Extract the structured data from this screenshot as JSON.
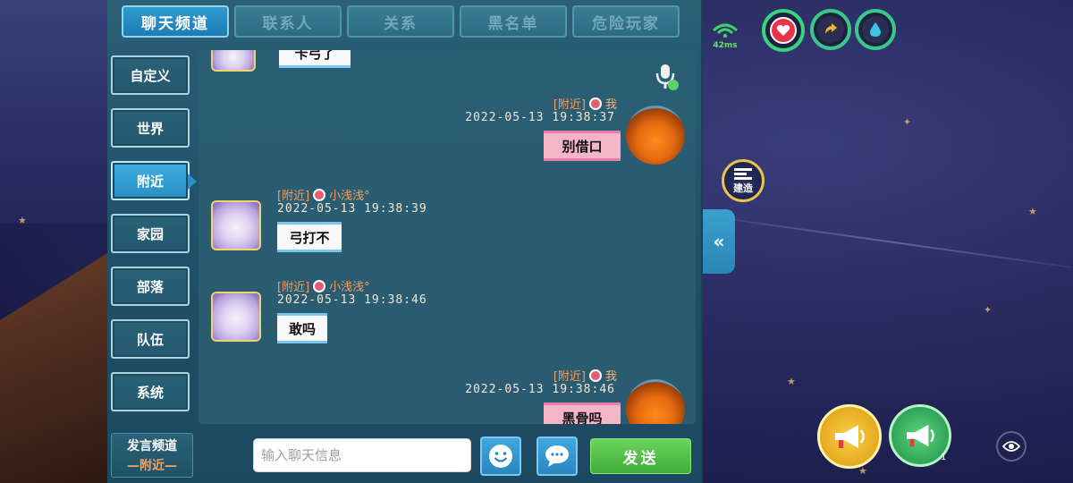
{
  "tabs": [
    {
      "label": "聊天频道",
      "active": true
    },
    {
      "label": "联系人",
      "active": false
    },
    {
      "label": "关系",
      "active": false
    },
    {
      "label": "黑名单",
      "active": false
    },
    {
      "label": "危险玩家",
      "active": false
    }
  ],
  "sidebar": {
    "items": [
      {
        "label": "自定义",
        "active": false
      },
      {
        "label": "世界",
        "active": false
      },
      {
        "label": "附近",
        "active": true
      },
      {
        "label": "家园",
        "active": false
      },
      {
        "label": "部落",
        "active": false
      },
      {
        "label": "队伍",
        "active": false
      },
      {
        "label": "系统",
        "active": false
      }
    ]
  },
  "messages": [
    {
      "channel": "",
      "name": "",
      "time": "",
      "text": "卡弓了",
      "side": "left",
      "partial": true
    },
    {
      "channel": "[附近]",
      "name": "我",
      "time": "2022-05-13  19:38:37",
      "text": "别借口",
      "side": "right"
    },
    {
      "channel": "[附近]",
      "name": "小浅浅°",
      "time": "2022-05-13  19:38:39",
      "text": "弓打不",
      "side": "left"
    },
    {
      "channel": "[附近]",
      "name": "小浅浅°",
      "time": "2022-05-13  19:38:46",
      "text": "敢吗",
      "side": "left"
    },
    {
      "channel": "[附近]",
      "name": "我",
      "time": "2022-05-13  19:38:46",
      "text": "黑骨吗",
      "side": "right"
    }
  ],
  "input_bar": {
    "channel_label": "发言频道",
    "channel_value": "—附近—",
    "placeholder": "输入聊天信息",
    "send_label": "发送"
  },
  "hud": {
    "ping": "42ms",
    "build_label": "建造",
    "horn_count": "1"
  },
  "icons": [
    "microphone-icon",
    "emoji-icon",
    "speech-bubble-icon",
    "collapse-icon",
    "wifi-icon",
    "heart-icon",
    "stamina-icon",
    "water-icon",
    "build-icon",
    "megaphone-icon",
    "eye-icon",
    "female-icon"
  ],
  "colors": {
    "panel": "#21506a",
    "tab_active": "#2f9bd0",
    "send": "#3fae3a",
    "bubble_other": "#f6f8fa",
    "bubble_me": "#f4b5c9",
    "channel_tag": "#ff9a5a"
  }
}
